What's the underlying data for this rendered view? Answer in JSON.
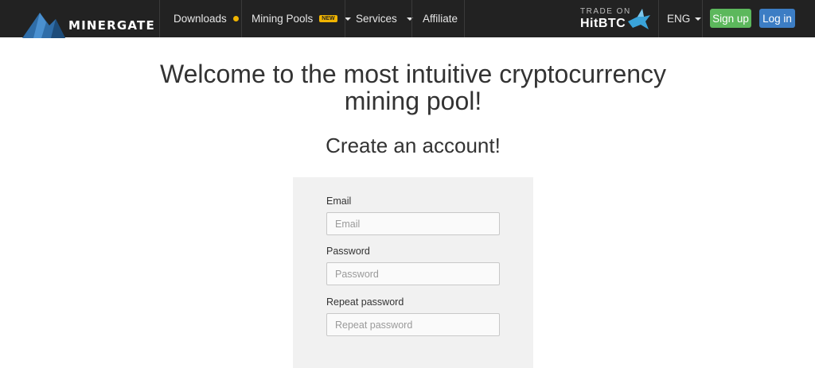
{
  "brand": {
    "name": "MinerGate",
    "logo_text": "MINERGATE"
  },
  "nav": {
    "downloads": "Downloads",
    "mining_pools": "Mining Pools",
    "new_badge": "NEW",
    "services": "Services",
    "affiliate": "Affiliate"
  },
  "promo": {
    "small": "TRADE ON",
    "big": "HitBTC"
  },
  "language": "ENG",
  "auth": {
    "signup": "Sign up",
    "login": "Log in"
  },
  "hero": {
    "title_line1": "Welcome to the most intuitive cryptocurrency",
    "title_line2": "mining pool!",
    "subtitle": "Create an account!"
  },
  "form": {
    "email_label": "Email",
    "email_placeholder": "Email",
    "password_label": "Password",
    "password_placeholder": "Password",
    "repeat_label": "Repeat password",
    "repeat_placeholder": "Repeat password"
  },
  "colors": {
    "navbar": "#222222",
    "accent_yellow": "#f0b400",
    "signup": "#5cb85c",
    "login": "#3c7dc4",
    "panel": "#f1f1f1"
  }
}
